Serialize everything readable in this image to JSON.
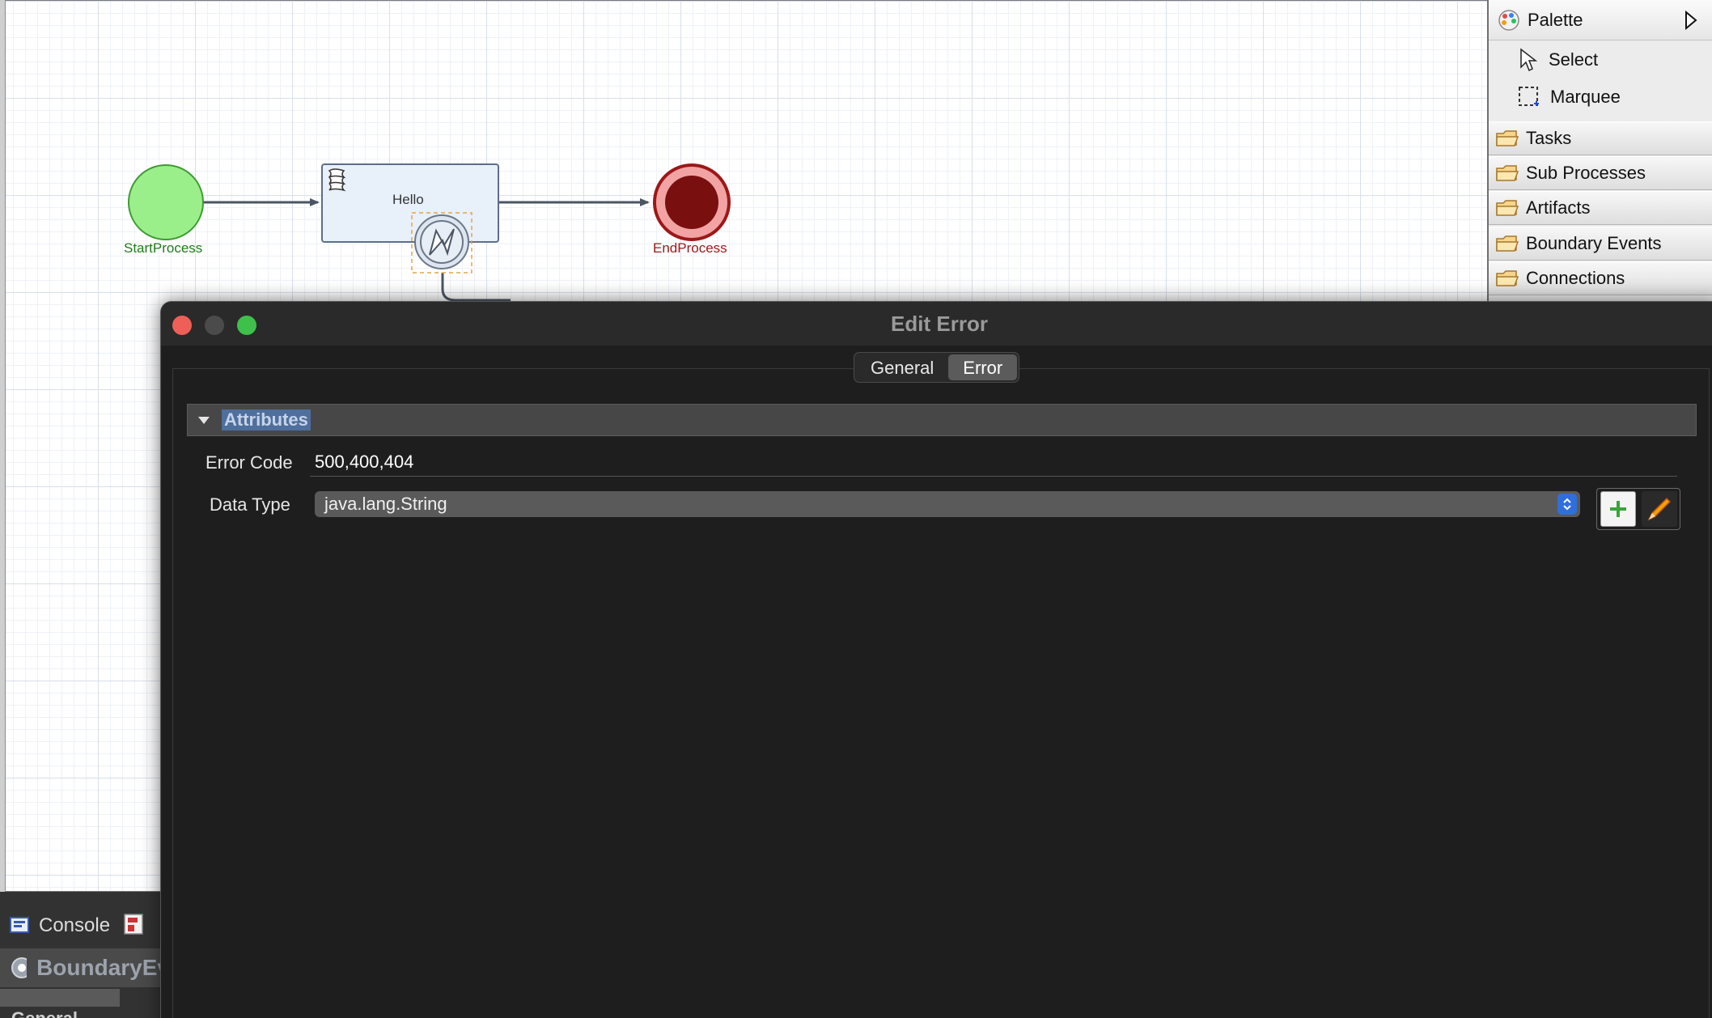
{
  "diagram": {
    "start_label": "StartProcess",
    "task_label": "Hello",
    "end_label": "EndProcess",
    "start_color": "#9bef8b",
    "end_color": "#7a0f0f"
  },
  "palette": {
    "title": "Palette",
    "tools": [
      {
        "label": "Select",
        "icon": "arrow-pointer-icon"
      },
      {
        "label": "Marquee",
        "icon": "marquee-icon"
      }
    ],
    "drawers": [
      {
        "label": "Tasks"
      },
      {
        "label": "Sub Processes"
      },
      {
        "label": "Artifacts"
      },
      {
        "label": "Boundary Events"
      },
      {
        "label": "Connections"
      }
    ]
  },
  "bottom": {
    "console_label": "Console",
    "boundary_title": "BoundaryEv",
    "general_peek": "General"
  },
  "dialog": {
    "title": "Edit Error",
    "tabs": [
      {
        "label": "General",
        "active": false
      },
      {
        "label": "Error",
        "active": true
      }
    ],
    "section_title": "Attributes",
    "fields": {
      "error_code_label": "Error Code",
      "error_code_value": "500,400,404",
      "data_type_label": "Data Type",
      "data_type_value": "java.lang.String"
    },
    "accent": "#2f6fdc"
  }
}
